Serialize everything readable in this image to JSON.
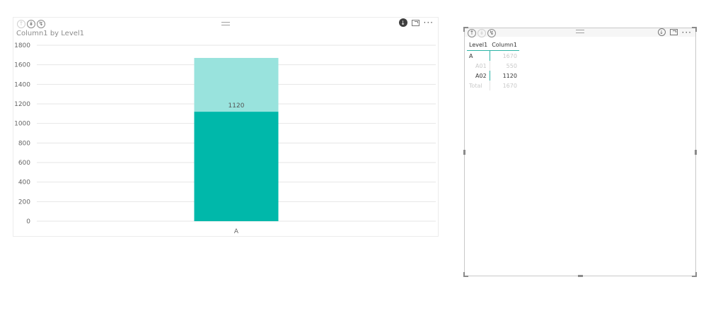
{
  "chart_visual": {
    "title": "Column1 by Level1",
    "icons": [
      "drill-up-icon",
      "drill-down-icon",
      "expand-all-icon",
      "download-icon",
      "focus-mode-icon",
      "more-options-icon"
    ],
    "more_label": "···"
  },
  "chart_data": {
    "type": "bar",
    "categories": [
      "A"
    ],
    "series": [
      {
        "values": [
          1120
        ],
        "color": "#00b8aa"
      },
      {
        "values": [
          550
        ],
        "color": "#99e3dd"
      }
    ],
    "total": [
      1670
    ],
    "data_labels": [
      "1120"
    ],
    "ylim": [
      0,
      1800
    ],
    "yticks": [
      0,
      200,
      400,
      600,
      800,
      1000,
      1200,
      1400,
      1600,
      1800
    ],
    "xlabel": "",
    "ylabel": "",
    "grid": true
  },
  "table_visual": {
    "more_label": "···",
    "headers": [
      "Level1",
      "Column1"
    ],
    "rows": [
      {
        "label": "A",
        "value": "1670",
        "style": "parent"
      },
      {
        "label": "A01",
        "value": "550",
        "style": "muted"
      },
      {
        "label": "A02",
        "value": "1120",
        "style": "selected"
      },
      {
        "label": "Total",
        "value": "1670",
        "style": "total"
      }
    ]
  }
}
